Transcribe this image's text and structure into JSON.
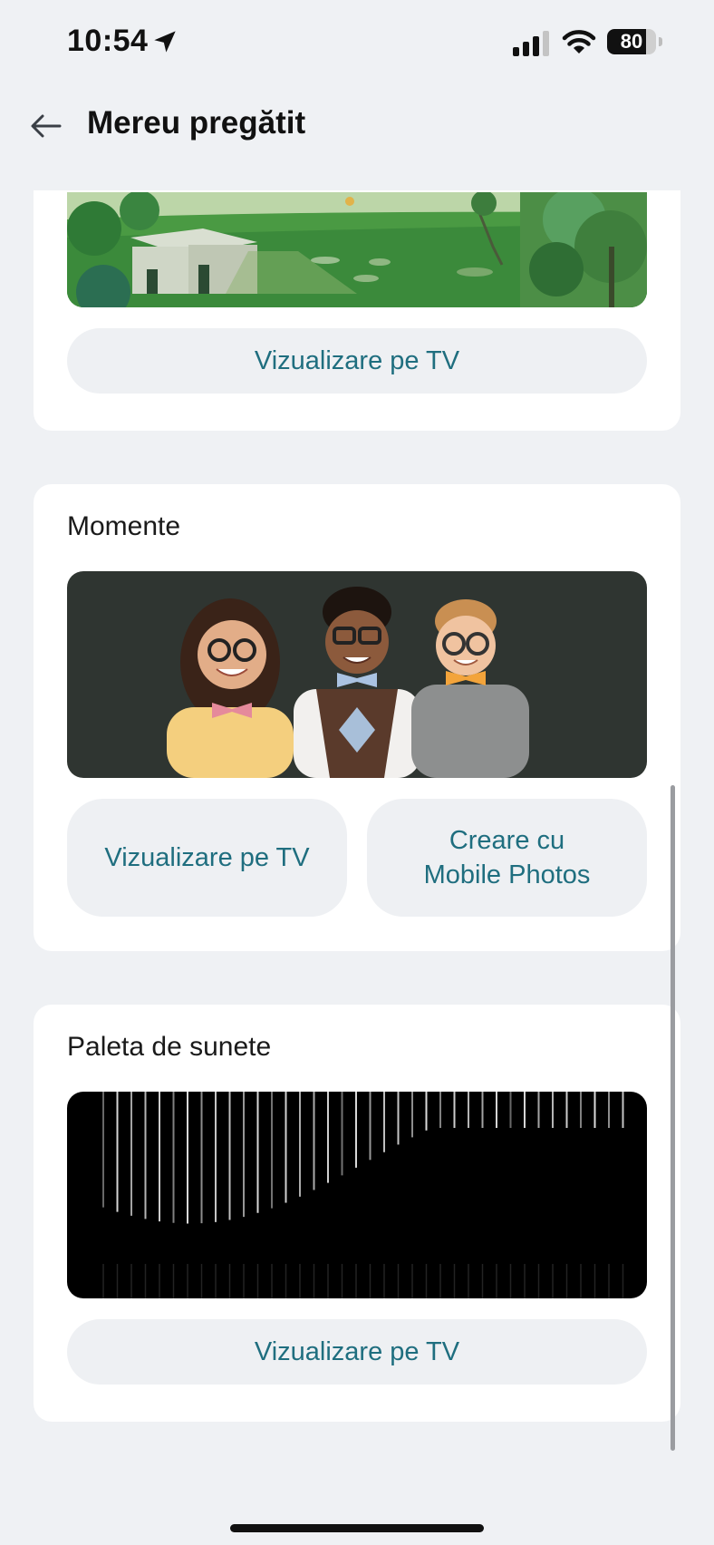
{
  "status": {
    "time": "10:54",
    "battery": "80",
    "battery_level": 0.8
  },
  "header": {
    "title": "Mereu pregătit"
  },
  "cards": [
    {
      "buttons": [
        "Vizualizare pe TV"
      ]
    },
    {
      "title": "Momente",
      "buttons": [
        "Vizualizare pe TV",
        "Creare cu\nMobile Photos"
      ]
    },
    {
      "title": "Paleta de sunete",
      "buttons": [
        "Vizualizare pe TV"
      ]
    }
  ],
  "colors": {
    "background": "#eff1f4",
    "card": "#ffffff",
    "button_bg": "#eef0f3",
    "button_text": "#1f6e7f"
  },
  "icons": {
    "location": "location-arrow-icon",
    "signal": "cellular-signal-icon",
    "wifi": "wifi-icon",
    "battery": "battery-icon",
    "back": "back-arrow-icon"
  }
}
